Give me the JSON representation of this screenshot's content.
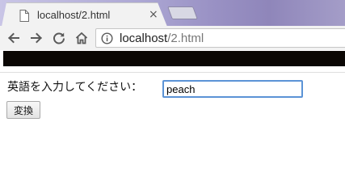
{
  "tab": {
    "title": "localhost/2.html",
    "close_glyph": "×",
    "favicon_icon": "page-icon"
  },
  "toolbar": {
    "back_icon": "back-arrow-icon",
    "forward_icon": "forward-arrow-icon",
    "reload_icon": "reload-icon",
    "home_icon": "home-icon"
  },
  "address": {
    "host": "localhost",
    "path": "/2.html",
    "security_icon": "info-icon"
  },
  "form": {
    "prompt": "英語を入力してください：",
    "input_value": "peach",
    "button_label": "変換"
  },
  "colors": {
    "focus_ring": "#5b93d6",
    "bookmarks_bar": "#0b0704",
    "toolbar": "#f2f2f2"
  }
}
